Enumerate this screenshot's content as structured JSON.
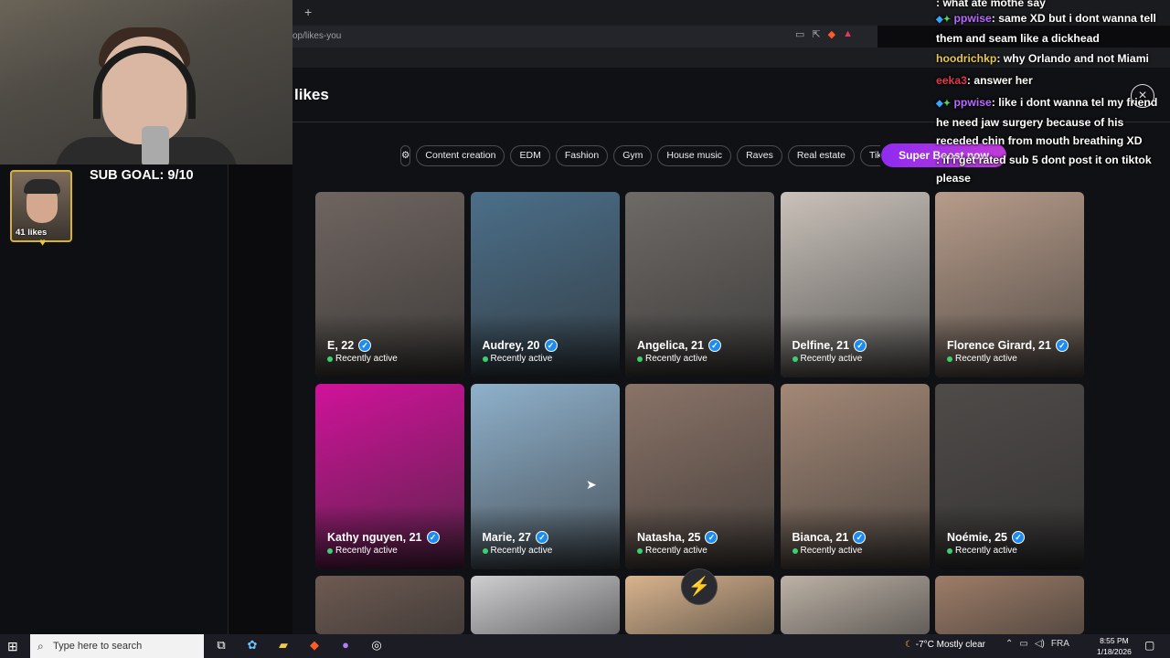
{
  "browser": {
    "new_tab": "+",
    "url": "op/likes-you",
    "icons": [
      "screen-icon",
      "share-icon",
      "brave-icon",
      "bat-icon"
    ]
  },
  "page": {
    "title": "likes",
    "filters": [
      "Content creation",
      "EDM",
      "Fashion",
      "Gym",
      "House music",
      "Raves",
      "Real estate",
      "TikTo"
    ],
    "super_boost_label": "Super Boost now",
    "cards": [
      {
        "name": "E, 22",
        "status": "Recently active",
        "bg": "#6f6560"
      },
      {
        "name": "Audrey, 20",
        "status": "Recently active",
        "bg": "#4b6f8a"
      },
      {
        "name": "Angelica, 21",
        "status": "Recently active",
        "bg": "#6e6a66"
      },
      {
        "name": "Delfine, 21",
        "status": "Recently active",
        "bg": "#c9c2ba"
      },
      {
        "name": "Florence Girard, 21",
        "status": "Recently active",
        "bg": "#b79c8a"
      },
      {
        "name": "Kathy nguyen, 21",
        "status": "Recently active",
        "bg": "#d0129a"
      },
      {
        "name": "Marie, 27",
        "status": "Recently active",
        "bg": "#8fb1cc"
      },
      {
        "name": "Natasha, 25",
        "status": "Recently active",
        "bg": "#8a7367"
      },
      {
        "name": "Bianca, 21",
        "status": "Recently active",
        "bg": "#a38876"
      },
      {
        "name": "Noémie, 25",
        "status": "Recently active",
        "bg": "#4f4b49"
      }
    ],
    "partial_cards": [
      "#6e5a52",
      "#cfcfd2",
      "#d9b48e",
      "#bdb2a6",
      "#9e7d68"
    ],
    "bolt": "⚡"
  },
  "stream": {
    "sub_goal": "SUB GOAL: 9/10",
    "likes_badge": "41 likes",
    "heart": "♥"
  },
  "chat": {
    "lines": [
      {
        "user": "",
        "text": ": what ate mothe say"
      },
      {
        "user": "ppwise",
        "text": ": same XD but i dont wanna tell them and seam like a dickhead"
      },
      {
        "user": "hoodrichkp",
        "text": ": why Orlando and not Miami"
      },
      {
        "user": "eeka3",
        "text": ": answer her"
      },
      {
        "user": "ppwise",
        "text": ": like i dont wanna tel my friend he need jaw surgery because of his receded chin from mouth breathing XD"
      },
      {
        "user": "",
        "text": ": if i get rated sub 5 dont post it on tiktok please"
      }
    ],
    "close_icon": "×"
  },
  "taskbar": {
    "search_placeholder": "Type here to search",
    "weather": "-7°C  Mostly clear",
    "lang": "FRA",
    "time": "8:55 PM",
    "date": "1/18/2026"
  }
}
